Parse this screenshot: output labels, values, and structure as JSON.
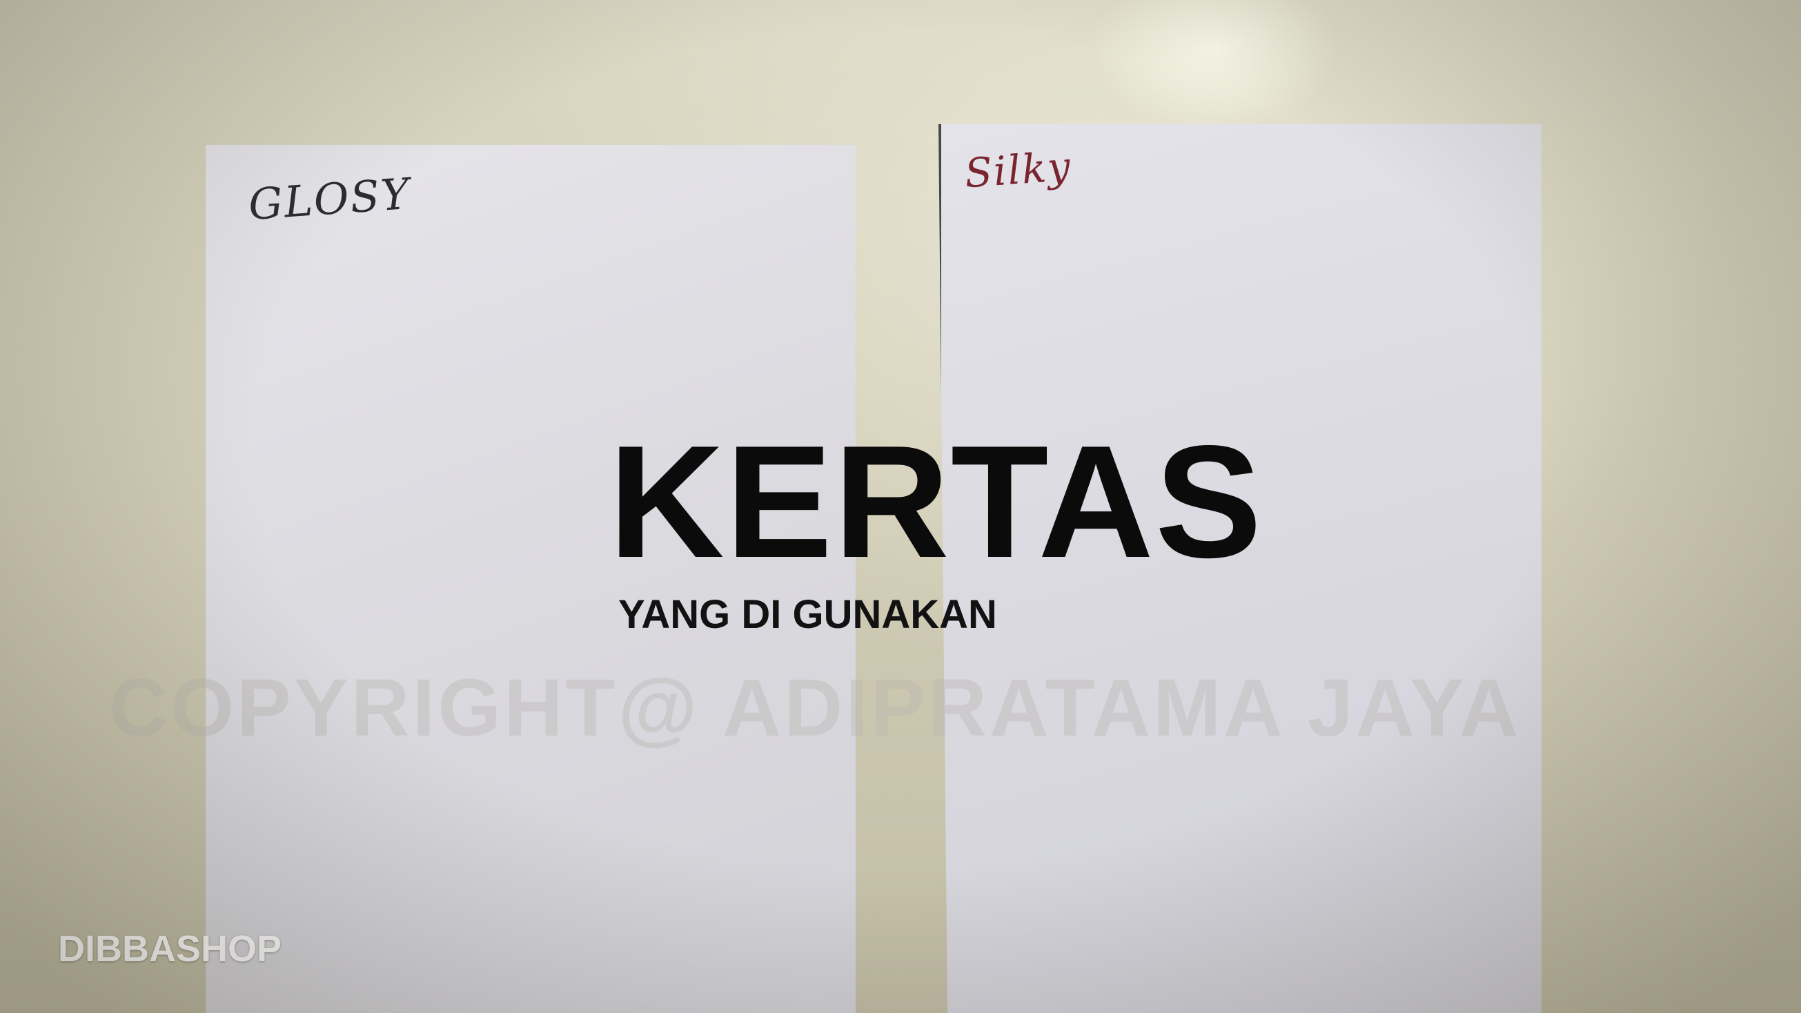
{
  "scene": {
    "description_free": true,
    "papers": [
      {
        "id": "glossy",
        "label": "GLOSY",
        "ink_color": "#2d2b2d"
      },
      {
        "id": "silky",
        "label": "Silky",
        "ink_color": "#7a2430"
      }
    ]
  },
  "overlay": {
    "title": "KERTAS",
    "subtitle": "YANG DI GUNAKAN",
    "watermark": "COPYRIGHT@ ADIPRATAMA JAYA",
    "brand": "DIBBASHOP"
  },
  "colors": {
    "title": "#0b0b0b",
    "brand": "#ffffff",
    "background": "#cfcab3",
    "paper": "#dcdbe0"
  }
}
